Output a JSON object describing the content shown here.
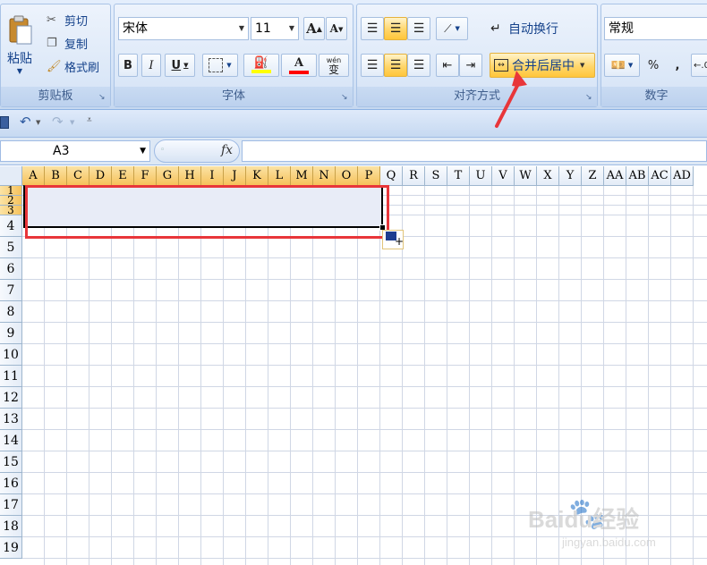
{
  "clipboard": {
    "paste_label": "粘贴",
    "cut_label": "剪切",
    "copy_label": "复制",
    "format_painter_label": "格式刷",
    "group_label": "剪贴板"
  },
  "font": {
    "font_name": "宋体",
    "font_size": "11",
    "grow_label": "A",
    "shrink_label": "A",
    "bold_label": "B",
    "italic_label": "I",
    "underline_label": "U",
    "font_color_label": "A",
    "phonetic_label": "wén",
    "phonetic_char": "变",
    "group_label": "字体",
    "fill_color": "#ffff00",
    "font_color": "#ff0000"
  },
  "alignment": {
    "wrap_text_label": "自动换行",
    "merge_center_label": "合并后居中",
    "group_label": "对齐方式"
  },
  "number": {
    "format_value": "常规",
    "percent_label": "%",
    "comma_label": ",",
    "group_label": "数字"
  },
  "formula_bar": {
    "name_box": "A3",
    "fx_label": "fx"
  },
  "sheet": {
    "columns": [
      "A",
      "B",
      "C",
      "D",
      "E",
      "F",
      "G",
      "H",
      "I",
      "J",
      "K",
      "L",
      "M",
      "N",
      "O",
      "P",
      "Q",
      "R",
      "S",
      "T",
      "U",
      "V",
      "W",
      "X",
      "Y",
      "Z",
      "AA",
      "AB",
      "AC",
      "AD"
    ],
    "rows": [
      "1",
      "2",
      "3",
      "4",
      "5",
      "6",
      "7",
      "8",
      "9",
      "10",
      "11",
      "12",
      "13",
      "14",
      "15",
      "16",
      "17",
      "18",
      "19"
    ],
    "selected_columns": [
      "A",
      "B",
      "C",
      "D",
      "E",
      "F",
      "G",
      "H",
      "I",
      "J",
      "K",
      "L",
      "M",
      "N",
      "O",
      "P"
    ],
    "selected_rows": [
      "1",
      "2",
      "3"
    ]
  },
  "watermark": {
    "brand": "Baidu经验",
    "url": "jingyan.baidu.com"
  },
  "colors": {
    "highlight_box": "#e8363a",
    "arrow": "#e8363a",
    "selection_fill": "#e8ecf7"
  }
}
